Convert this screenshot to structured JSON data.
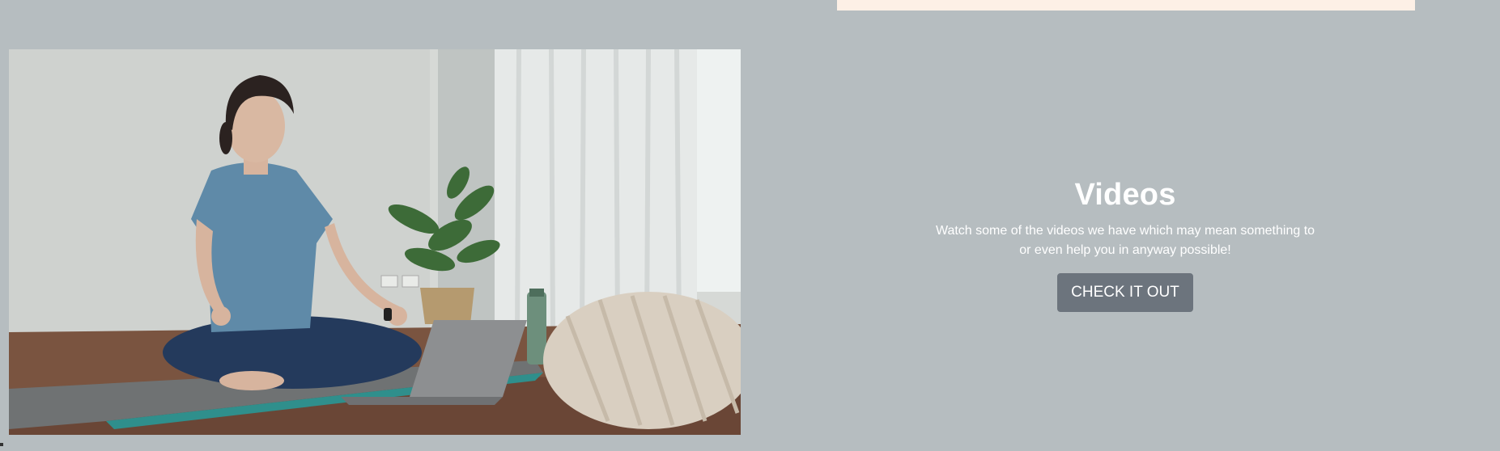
{
  "section": {
    "title": "Videos",
    "description": "Watch some of the videos we have which may mean something to or even help you in anyway possible!",
    "button_label": "CHECK IT OUT"
  },
  "colors": {
    "background": "#b6bdc0",
    "top_strip": "#fdf0e6",
    "button": "#6c747d",
    "text": "#ffffff"
  }
}
